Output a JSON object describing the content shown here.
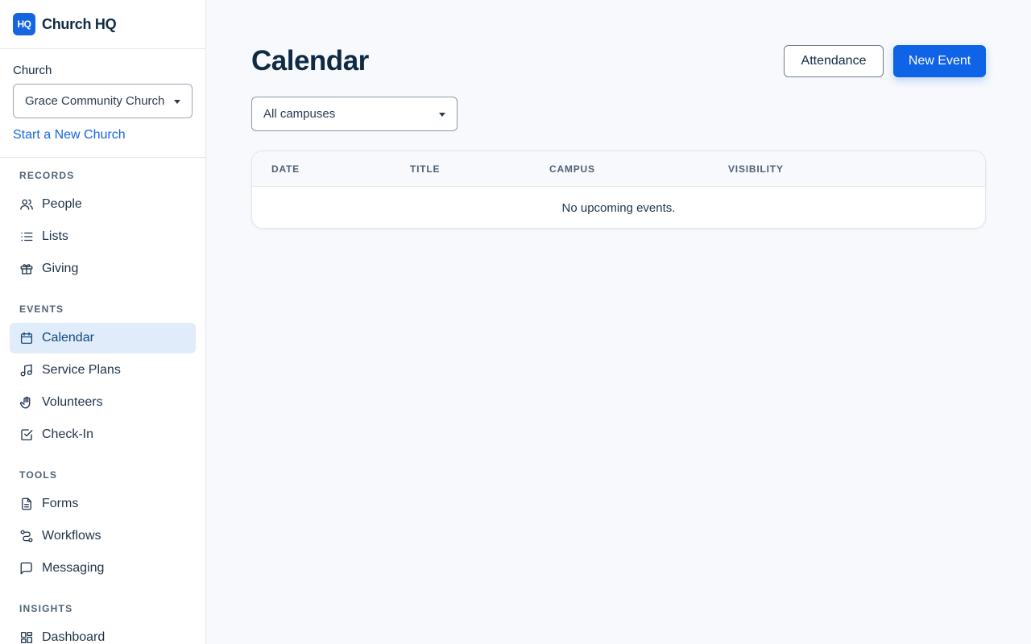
{
  "brand": {
    "logo_text": "HQ",
    "name": "Church HQ",
    "logo_color": "#1565e0"
  },
  "church": {
    "label": "Church",
    "selected": "Grace Community Church",
    "new_link": "Start a New Church"
  },
  "nav": {
    "records": {
      "title": "RECORDS",
      "items": [
        {
          "label": "People",
          "icon": "users-icon"
        },
        {
          "label": "Lists",
          "icon": "list-icon"
        },
        {
          "label": "Giving",
          "icon": "gift-icon"
        }
      ]
    },
    "events": {
      "title": "EVENTS",
      "items": [
        {
          "label": "Calendar",
          "icon": "calendar-icon",
          "active": true
        },
        {
          "label": "Service Plans",
          "icon": "music-icon"
        },
        {
          "label": "Volunteers",
          "icon": "hand-icon"
        },
        {
          "label": "Check-In",
          "icon": "check-square-icon"
        }
      ]
    },
    "tools": {
      "title": "TOOLS",
      "items": [
        {
          "label": "Forms",
          "icon": "file-icon"
        },
        {
          "label": "Workflows",
          "icon": "workflow-icon"
        },
        {
          "label": "Messaging",
          "icon": "message-icon"
        }
      ]
    },
    "insights": {
      "title": "INSIGHTS",
      "items": [
        {
          "label": "Dashboard",
          "icon": "dashboard-icon"
        }
      ]
    }
  },
  "page": {
    "title": "Calendar",
    "attendance_label": "Attendance",
    "new_event_label": "New Event",
    "campus_filter": "All campuses"
  },
  "table": {
    "columns": [
      "DATE",
      "TITLE",
      "CAMPUS",
      "VISIBILITY"
    ],
    "empty_message": "No upcoming events."
  },
  "colors": {
    "accent": "#0f63e6",
    "active_nav_bg": "#e1ecfb",
    "text": "#0f2a44"
  }
}
